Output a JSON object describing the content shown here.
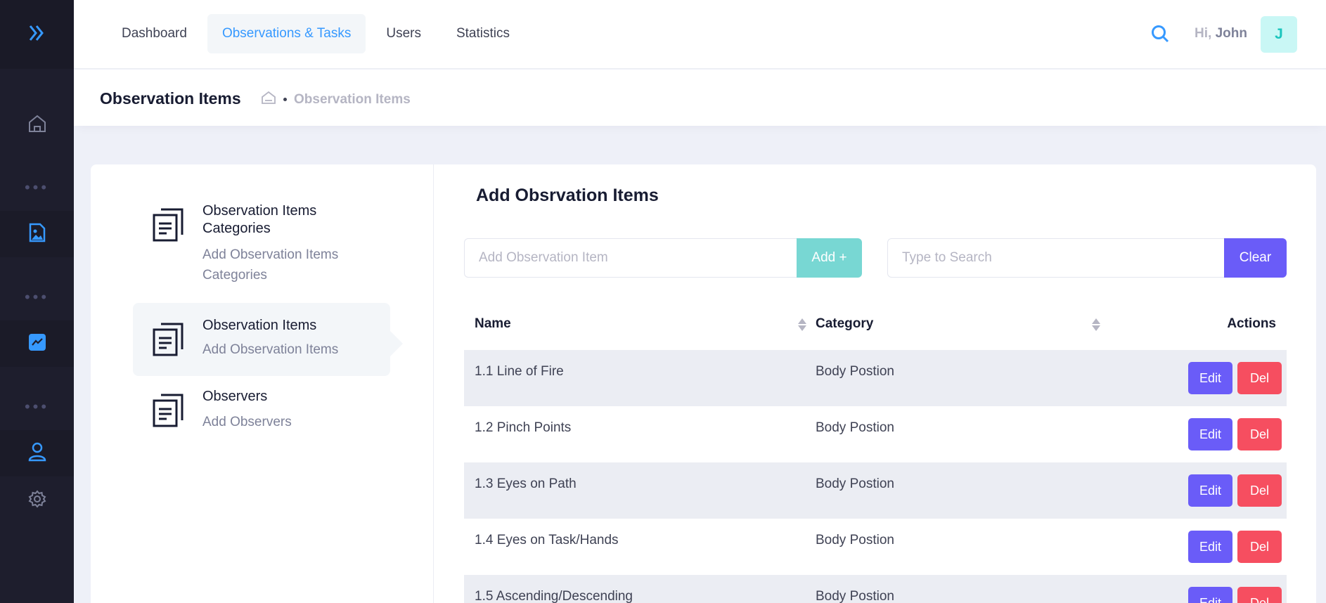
{
  "nav": {
    "items": [
      "Dashboard",
      "Observations & Tasks",
      "Users",
      "Statistics"
    ],
    "active": 1
  },
  "user": {
    "greeting": "Hi,",
    "name": "John",
    "initial": "J"
  },
  "subheader": {
    "title": "Observation Items",
    "breadcrumb_current": "Observation Items"
  },
  "menu": [
    {
      "title": "Observation Items Categories",
      "desc": "Add Observation Items Categories"
    },
    {
      "title": "Observation Items",
      "desc": "Add Observation Items"
    },
    {
      "title": "Observers",
      "desc": "Add Observers"
    }
  ],
  "content": {
    "title": "Add Obsrvation Items",
    "add_placeholder": "Add Observation Item",
    "add_button": "Add +",
    "search_placeholder": "Type to Search",
    "clear_button": "Clear"
  },
  "table": {
    "headers": {
      "name": "Name",
      "category": "Category",
      "actions": "Actions"
    },
    "edit_label": "Edit",
    "del_label": "Del",
    "rows": [
      {
        "name": "1.1 Line of Fire",
        "category": "Body Postion"
      },
      {
        "name": "1.2 Pinch Points",
        "category": "Body Postion"
      },
      {
        "name": "1.3 Eyes on Path",
        "category": "Body Postion"
      },
      {
        "name": "1.4 Eyes on Task/Hands",
        "category": "Body Postion"
      },
      {
        "name": "1.5 Ascending/Descending",
        "category": "Body Postion"
      }
    ]
  },
  "colors": {
    "accent": "#3699ff",
    "add": "#78d7d3",
    "clear": "#6a5cf8",
    "edit": "#6a5cf8",
    "del": "#f64e60"
  }
}
